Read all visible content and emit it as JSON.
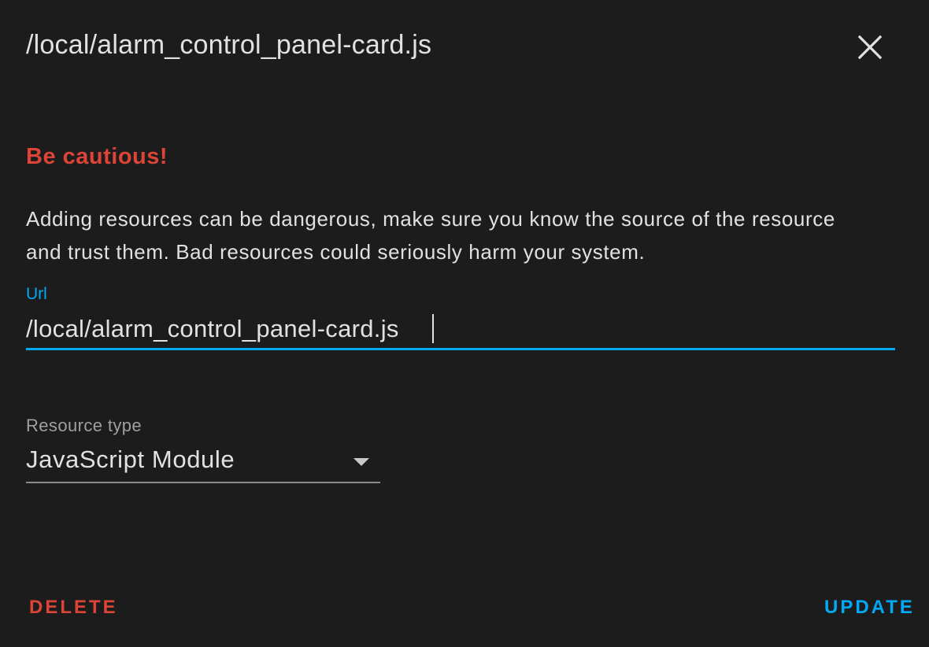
{
  "dialog": {
    "title": "/local/alarm_control_panel-card.js",
    "close_icon": "close-icon"
  },
  "warning": {
    "title": "Be cautious!",
    "text": "Adding resources can be dangerous, make sure you know the source of the resource and trust them. Bad resources could seriously harm your system."
  },
  "url_field": {
    "label": "Url",
    "value": "/local/alarm_control_panel-card.js"
  },
  "resource_type": {
    "label": "Resource type",
    "selected": "JavaScript Module",
    "arrow_icon": "dropdown-arrow-icon"
  },
  "actions": {
    "delete_label": "DELETE",
    "update_label": "UPDATE"
  },
  "colors": {
    "background": "#1c1c1c",
    "text": "#e1e1e1",
    "accent": "#03a9f4",
    "danger": "#db4437",
    "secondary_text": "#a0a0a0"
  }
}
